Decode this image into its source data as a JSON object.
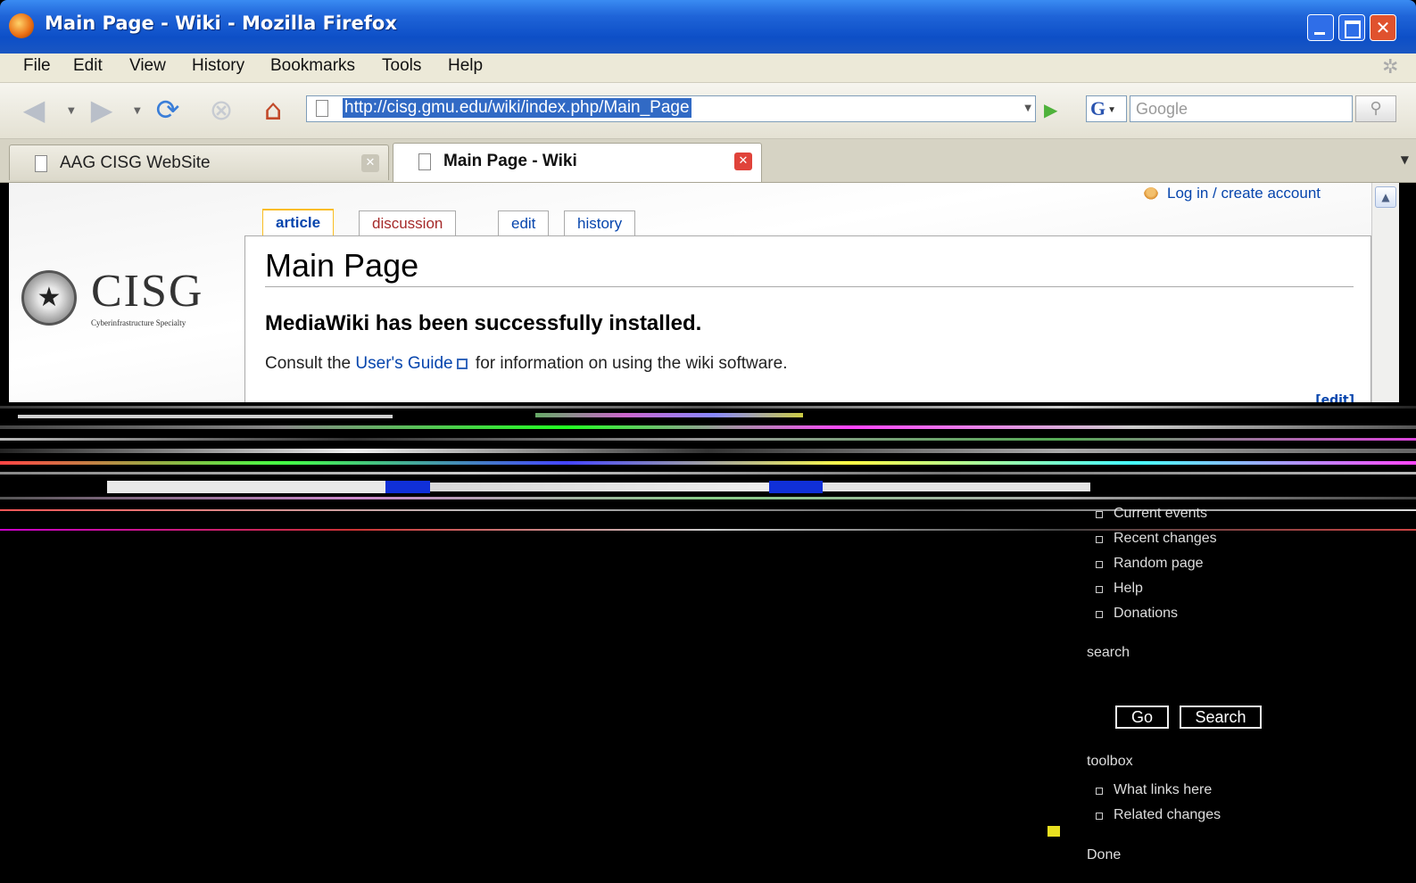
{
  "window": {
    "title": "Main Page - Wiki - Mozilla Firefox",
    "controls": [
      "minimize",
      "maximize",
      "close"
    ]
  },
  "menu": [
    "File",
    "Edit",
    "View",
    "History",
    "Bookmarks",
    "Tools",
    "Help"
  ],
  "toolbar": {
    "url": "http://cisg.gmu.edu/wiki/index.php/Main_Page",
    "search_engine_glyph": "G",
    "search_placeholder": "Google"
  },
  "tabs": [
    {
      "label": "AAG CISG WebSite",
      "active": false
    },
    {
      "label": "Main Page - Wiki",
      "active": true
    }
  ],
  "page": {
    "user_link": "Log in / create account",
    "logo_name": "CISG",
    "logo_tagline": "Cyberinfrastructure Specialty",
    "page_tabs": [
      "article",
      "discussion",
      "edit",
      "history"
    ],
    "title": "Main Page",
    "heading": "MediaWiki has been successfully installed.",
    "para_before": "Consult the ",
    "para_link": "User's Guide",
    "para_after": " for information on using the wiki software.",
    "edit_link": "[edit]"
  },
  "sidebar": {
    "navigation_items": [
      "Current events",
      "Recent changes",
      "Random page",
      "Help",
      "Donations"
    ],
    "search_label": "search",
    "go_button": "Go",
    "search_button": "Search",
    "toolbox_label": "toolbox",
    "toolbox_items": [
      "What links here",
      "Related changes"
    ]
  },
  "status": "Done"
}
